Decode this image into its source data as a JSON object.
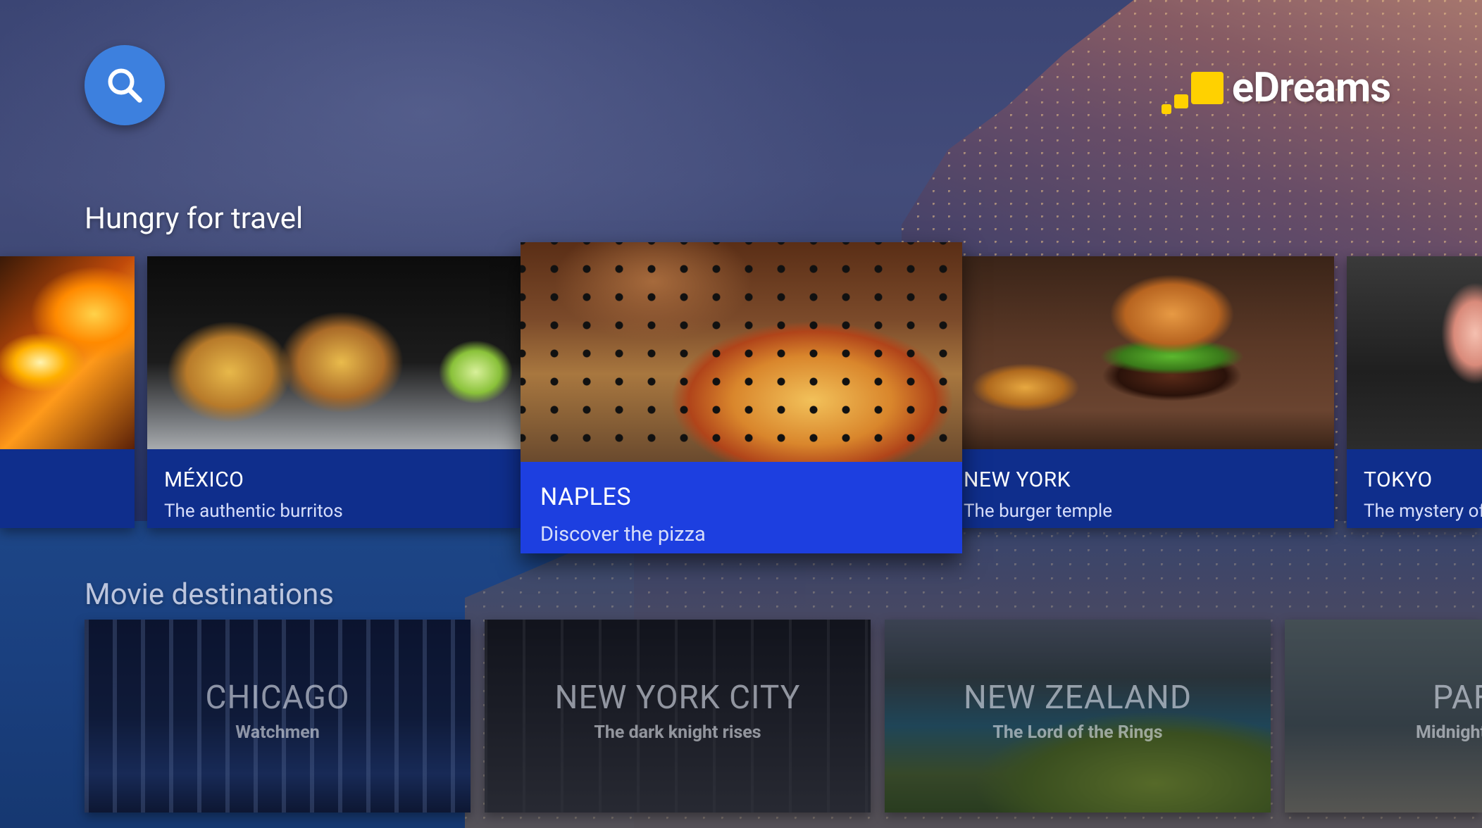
{
  "header": {
    "search_icon": "search-icon",
    "logo_text": "eDreams",
    "brand_color": "#ffd100"
  },
  "rows": [
    {
      "title": "Hungry for travel",
      "cards": [
        {
          "city": "",
          "tagline": "",
          "image": "fire"
        },
        {
          "city": "MÉXICO",
          "tagline": "The authentic burritos",
          "image": "tacos"
        },
        {
          "city": "NAPLES",
          "tagline": "Discover the pizza",
          "image": "pizza",
          "focused": true
        },
        {
          "city": "NEW YORK",
          "tagline": "The burger temple",
          "image": "burger"
        },
        {
          "city": "TOKYO",
          "tagline": "The mystery of s",
          "image": "tokyo"
        }
      ]
    },
    {
      "title": "Movie destinations",
      "cards": [
        {
          "city": "CHICAGO",
          "movie": "Watchmen"
        },
        {
          "city": "NEW YORK CITY",
          "movie": "The dark knight rises"
        },
        {
          "city": "NEW ZEALAND",
          "movie": "The Lord of the Rings"
        },
        {
          "city": "PAF",
          "movie": "Midnight"
        }
      ]
    }
  ],
  "colors": {
    "card_info": "#0f2e8c",
    "card_info_focused": "#1d3fe0",
    "search_button": "#3d80de"
  }
}
